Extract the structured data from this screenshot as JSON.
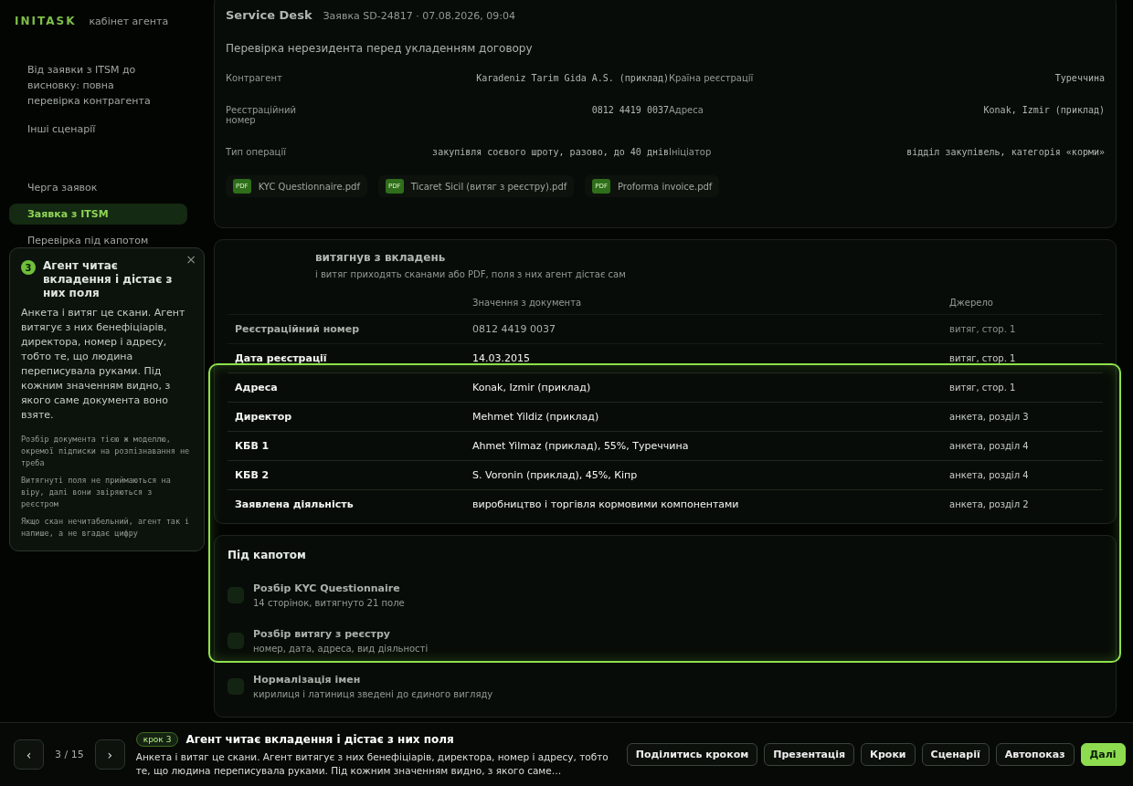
{
  "sidebar": {
    "logo": "INITASK",
    "subtitle": "кабінет агента",
    "scenario": {
      "label": "Від заявки з ITSM до висновку: повна перевірка контрагента"
    },
    "other": "Інші сценарії",
    "items": [
      {
        "label": "Черга заявок",
        "selected": false
      },
      {
        "label": "Заявка з ITSM",
        "selected": true
      },
      {
        "label": "Перевірка під капотом",
        "selected": false
      }
    ]
  },
  "request": {
    "source": "Service Desk",
    "meta": "Заявка SD-24817 · 07.08.2026, 09:04",
    "title": "Перевірка нерезидента перед укладенням договору",
    "fields": [
      {
        "label": "Контрагент",
        "value": "Karadeniz Tarim Gida A.S. (приклад)"
      },
      {
        "label": "Країна реєстрації",
        "value": "Туреччина"
      },
      {
        "label": "Реєстраційний номер",
        "value": "0812 4419 0037"
      },
      {
        "label": "Адреса",
        "value": "Konak, Izmir (приклад)"
      },
      {
        "label": "Тип операції",
        "value": "закупівля соєвого шроту, разово, до 40 днів"
      },
      {
        "label": "Ініціатор",
        "value": "відділ закупівель, категорія «корми»"
      }
    ],
    "attachments": [
      {
        "icon": "PDF",
        "name": "KYC Questionnaire.pdf"
      },
      {
        "icon": "PDF",
        "name": "Ticaret Sicil (витяг з реєстру).pdf"
      },
      {
        "icon": "PDF",
        "name": "Proforma invoice.pdf"
      }
    ]
  },
  "extraction": {
    "title": "витягнув з вкладень",
    "subtitle": "і витяг приходять сканами або PDF, поля з них агент дістає сам",
    "columns": [
      "Значення з документа",
      "Джерело"
    ],
    "rows": [
      {
        "field": "Реєстраційний номер",
        "value": "0812 4419 0037",
        "source": "витяг, стор. 1"
      },
      {
        "field": "Дата реєстрації",
        "value": "14.03.2015",
        "source": "витяг, стор. 1"
      },
      {
        "field": "Адреса",
        "value": "Konak, Izmir (приклад)",
        "source": "витяг, стор. 1"
      },
      {
        "field": "Директор",
        "value": "Mehmet Yildiz (приклад)",
        "source": "анкета, розділ 3"
      },
      {
        "field": "КБВ 1",
        "value": "Ahmet Yilmaz (приклад), 55%, Туреччина",
        "source": "анкета, розділ 4"
      },
      {
        "field": "КБВ 2",
        "value": "S. Voronin (приклад), 45%, Кіпр",
        "source": "анкета, розділ 4"
      },
      {
        "field": "Заявлена діяльність",
        "value": "виробництво і торгівля кормовими компонентами",
        "source": "анкета, розділ 2"
      }
    ]
  },
  "under_hood": {
    "title": "Під капотом",
    "steps": [
      {
        "title": "Розбір KYC Questionnaire",
        "detail": "14 сторінок, витягнуто 21 поле"
      },
      {
        "title": "Розбір витягу з реєстру",
        "detail": "номер, дата, адреса, вид діяльності"
      },
      {
        "title": "Нормалізація імен",
        "detail": "кирилиця і латиниця зведені до єдиного вигляду"
      }
    ]
  },
  "tooltip": {
    "number": "3",
    "title": "Агент читає вкладення і дістає з них поля",
    "close": "×",
    "body": "Анкета і витяг це скани. Агент витягує з них бенефіціарів, директора, номер і адресу, тобто те, що людина переписувала руками. Під кожним значенням видно, з якого саме документа воно взяте.",
    "notes": [
      "Розбір документа тією ж моделлю, окремої підписки на розпізнавання не треба",
      "Витягнуті поля не приймаються на віру, далі вони звіряються з реєстром",
      "Якщо скан нечитабельний, агент так і напише, а не вгадає цифру"
    ]
  },
  "footer": {
    "prev": "‹",
    "next": "›",
    "current": "3",
    "sep": "/",
    "total": "15",
    "badge": "крок 3",
    "title": "Агент читає вкладення і дістає з них поля",
    "text": "Анкета і витяг це скани. Агент витягує з них бенефіціарів, директора, номер і адресу, тобто те, що людина переписувала руками. Під кожним значенням видно, з якого саме…",
    "buttons": [
      {
        "label": "Поділитись кроком",
        "kind": "secondary"
      },
      {
        "label": "Презентація",
        "kind": "secondary"
      },
      {
        "label": "Кроки",
        "kind": "secondary"
      },
      {
        "label": "Сценарії",
        "kind": "secondary"
      },
      {
        "label": "Автопоказ",
        "kind": "secondary"
      },
      {
        "label": "Далі",
        "kind": "primary"
      }
    ]
  }
}
